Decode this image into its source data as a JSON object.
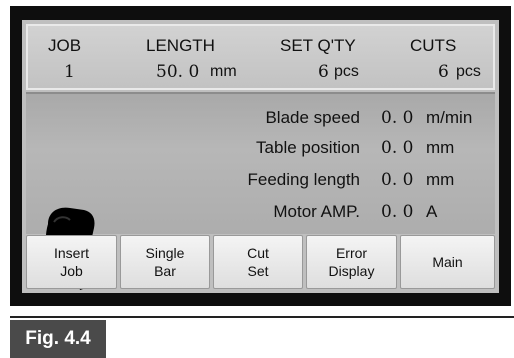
{
  "header": {
    "job_label": "JOB",
    "job_value": "1",
    "length_label": "LENGTH",
    "length_value": "50. 0",
    "length_unit": "mm",
    "setqty_label": "SET Q'TY",
    "setqty_value": "6",
    "setqty_unit": "pcs",
    "cuts_label": "CUTS",
    "cuts_value": "6",
    "cuts_unit": "pcs"
  },
  "readouts": [
    {
      "label": "Blade speed",
      "value": "0. 0",
      "unit": "m/min"
    },
    {
      "label": "Table position",
      "value": "0. 0",
      "unit": "mm"
    },
    {
      "label": "Feeding length",
      "value": "0. 0",
      "unit": "mm"
    },
    {
      "label": "Motor AMP.",
      "value": "0. 0",
      "unit": "A"
    }
  ],
  "buttons": [
    {
      "label": "Insert\nJob"
    },
    {
      "label": "Single\nBar"
    },
    {
      "label": "Cut\nSet"
    },
    {
      "label": "Error\nDisplay"
    },
    {
      "label": "Main"
    }
  ],
  "figure_caption": "Fig. 4.4",
  "icons": {
    "pointer": "pointing-hand-icon"
  }
}
